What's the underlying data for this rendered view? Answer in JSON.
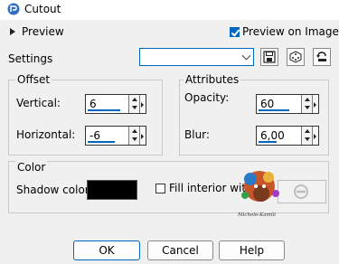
{
  "window": {
    "title": "Cutout"
  },
  "preview": {
    "toggle_label": "Preview",
    "preview_on_image_label": "Preview on Image",
    "preview_on_image_checked": true
  },
  "settings": {
    "label": "Settings",
    "value": ""
  },
  "offset": {
    "legend": "Offset",
    "vertical": {
      "label": "Vertical:",
      "value": "6"
    },
    "horizontal": {
      "label": "Horizontal:",
      "value": "-6"
    }
  },
  "attributes": {
    "legend": "Attributes",
    "opacity": {
      "label": "Opacity:",
      "value": "60"
    },
    "blur": {
      "label": "Blur:",
      "value": "6,00"
    }
  },
  "color": {
    "legend": "Color",
    "shadow_color_label": "Shadow color:",
    "shadow_color": "#000000",
    "fill_interior_label": "Fill interior wit",
    "fill_interior_checked": false
  },
  "watermark": {
    "text": "Michele-Kamili"
  },
  "buttons": {
    "ok": "OK",
    "cancel": "Cancel",
    "help": "Help"
  },
  "icons": [
    "app-icon",
    "save-icon",
    "dice-icon",
    "reset-icon",
    "no-sign-icon"
  ],
  "colors": {
    "accent": "#0067c0"
  }
}
